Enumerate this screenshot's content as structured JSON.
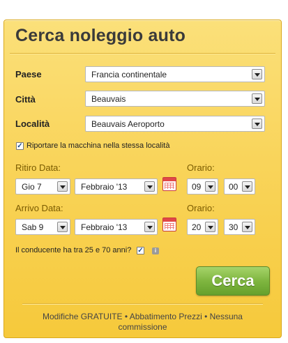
{
  "title": "Cerca noleggio auto",
  "fields": {
    "paese": {
      "label": "Paese",
      "value": "Francia continentale"
    },
    "citta": {
      "label": "Città",
      "value": "Beauvais"
    },
    "localita": {
      "label": "Località",
      "value": "Beauvais Aeroporto"
    }
  },
  "same_location": {
    "label": "Riportare la macchina nella stessa località",
    "checked": "✓"
  },
  "pickup": {
    "label": "Ritiro Data:",
    "day": "Gio 7",
    "month": "Febbraio '13",
    "time_label": "Orario:",
    "hour": "09",
    "minute": "00"
  },
  "dropoff": {
    "label": "Arrivo Data:",
    "day": "Sab 9",
    "month": "Febbraio '13",
    "time_label": "Orario:",
    "hour": "20",
    "minute": "30"
  },
  "driver_age": {
    "label": "Il conducente ha tra 25 e 70 anni?",
    "checked": "✓",
    "info": "i"
  },
  "search_button": "Cerca",
  "footer": "Modifiche GRATUITE • Abbatimento Prezzi • Nessuna commissione",
  "colors": {
    "panel": "#f9d45a",
    "button": "#7fb640",
    "accent_text": "#7a5b00"
  },
  "icons": [
    "calendar-icon",
    "info-icon",
    "chevron-down-icon"
  ]
}
